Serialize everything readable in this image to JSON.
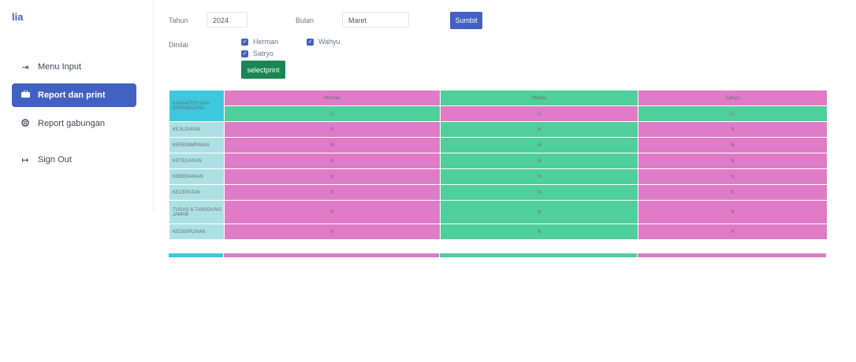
{
  "sidebar": {
    "brand": "lia",
    "items": [
      {
        "label": "Menu Input",
        "icon": "sign-in-icon"
      },
      {
        "label": "Report dan print",
        "icon": "briefcase-icon"
      },
      {
        "label": "Report gabungan",
        "icon": "lifebuoy-icon"
      },
      {
        "label": "Sign Out",
        "icon": "sign-out-icon"
      }
    ]
  },
  "form": {
    "tahun_label": "Tahun",
    "tahun_value": "2024",
    "bulan_label": "Bulan",
    "bulan_value": "Maret",
    "submit_label": "Sumbit",
    "dinilai_label": "Dinilai",
    "checkboxes": [
      "Herman",
      "Wahyu",
      "Satryo"
    ],
    "print_label": "selectprint"
  },
  "table": {
    "corner": "KARAKTER DAN KEPRIBADIAN",
    "columns": [
      "Herman",
      "Wahyu",
      "Satryo"
    ],
    "subheader": [
      "LI",
      "LI",
      "LI"
    ],
    "rows": [
      {
        "label": "KEJUJURAN",
        "values": [
          "N",
          "N",
          "N"
        ]
      },
      {
        "label": "KEPEMIMPINAN",
        "values": [
          "N",
          "N",
          "N"
        ]
      },
      {
        "label": "KETEGASAN",
        "values": [
          "N",
          "N",
          "N"
        ]
      },
      {
        "label": "KEBERANIAN",
        "values": [
          "N",
          "N",
          "N"
        ]
      },
      {
        "label": "KECEPATAN",
        "values": [
          "N",
          "N",
          "N"
        ]
      },
      {
        "label": "TUGAS & TANGGUNG JAWAB",
        "values": [
          "N",
          "N",
          "N"
        ]
      },
      {
        "label": "KEDISIPLINAN",
        "values": [
          "N",
          "N",
          "N"
        ]
      }
    ]
  },
  "colors": {
    "accent": "#4361c2",
    "print": "#198754",
    "pink": "#e07bc7",
    "green": "#4fcf9b",
    "cyan": "#3ec8de",
    "row_label": "#ace1e4"
  }
}
